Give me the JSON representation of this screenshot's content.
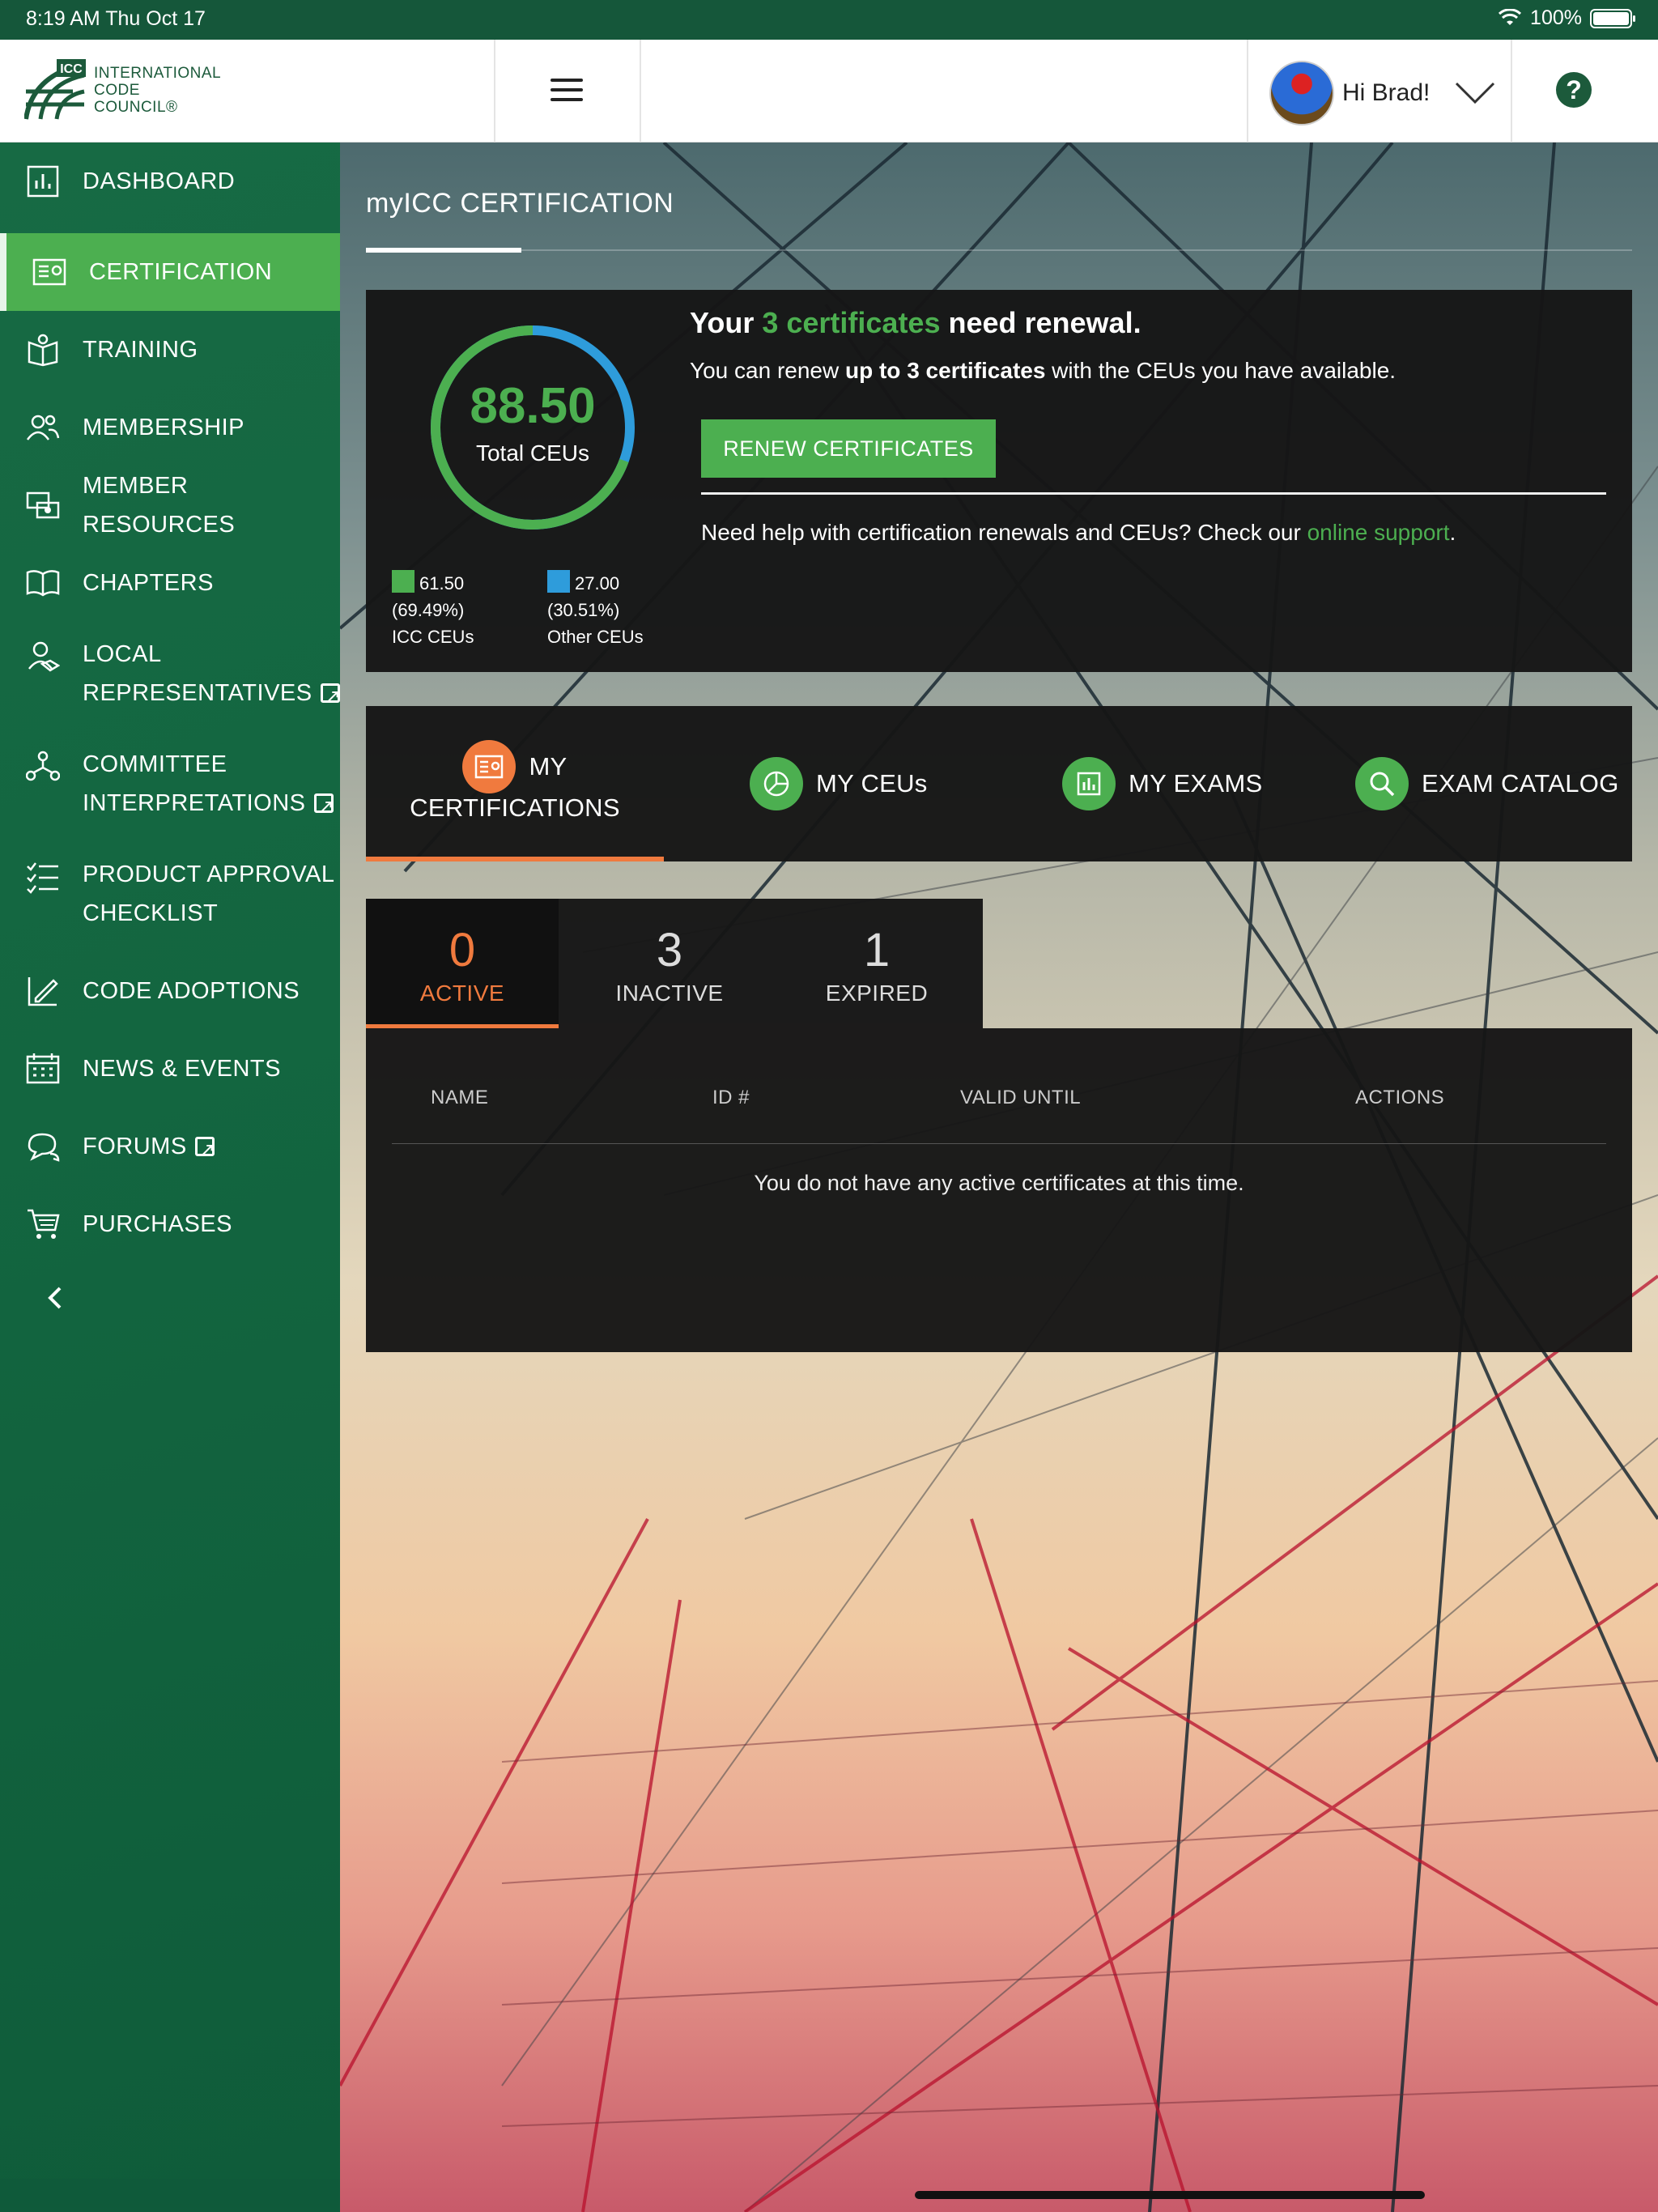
{
  "status_bar": {
    "time": "8:19 AM   Thu Oct 17",
    "battery": "100%"
  },
  "header": {
    "logo_mark": "ICC",
    "logo_lines": [
      "INTERNATIONAL",
      "CODE",
      "COUNCIL®"
    ],
    "greeting": "Hi Brad!",
    "help": "?"
  },
  "sidebar": {
    "items": [
      {
        "label": "DASHBOARD",
        "icon": "bar-chart-icon"
      },
      {
        "label": "CERTIFICATION",
        "icon": "certificate-icon"
      },
      {
        "label": "TRAINING",
        "icon": "training-icon"
      },
      {
        "label": "MEMBERSHIP",
        "icon": "people-icon"
      },
      {
        "label": "MEMBER RESOURCES",
        "icon": "resources-icon"
      },
      {
        "label": "CHAPTERS",
        "icon": "book-icon"
      },
      {
        "label": "LOCAL",
        "label2": "REPRESENTATIVES",
        "icon": "representatives-icon"
      },
      {
        "label": "COMMITTEE",
        "label2": "INTERPRETATIONS",
        "icon": "committee-icon"
      },
      {
        "label": "PRODUCT APPROVAL",
        "label2": "CHECKLIST",
        "icon": "checklist-icon"
      },
      {
        "label": "CODE ADOPTIONS",
        "icon": "code-adoption-icon"
      },
      {
        "label": "NEWS & EVENTS",
        "icon": "calendar-icon"
      },
      {
        "label": "FORUMS",
        "icon": "chat-icon"
      },
      {
        "label": "PURCHASES",
        "icon": "cart-icon"
      }
    ],
    "collapse": "‹"
  },
  "page": {
    "title": "myICC CERTIFICATION"
  },
  "ceu": {
    "total": "88.50",
    "total_label": "Total CEUs",
    "icc_value": "61.50",
    "icc_pct": "(69.49%)",
    "icc_label": "ICC CEUs",
    "other_value": "27.00",
    "other_pct": "(30.51%)",
    "other_label": "Other CEUs",
    "icc_fraction": 0.6949,
    "colors": {
      "icc": "#4caf50",
      "other": "#2e9cdb"
    }
  },
  "renewal": {
    "head_pre": "Your ",
    "head_hl": "3 certificates",
    "head_post": " need renewal.",
    "sub_pre": "You can renew ",
    "sub_bold": "up to 3 certificates",
    "sub_post": " with the CEUs you have available.",
    "button": "RENEW CERTIFICATES",
    "help_pre": "Need help with certification renewals and CEUs? Check our ",
    "help_link": "online support",
    "help_post": "."
  },
  "cert_tabs": [
    {
      "label": "MY",
      "label2": "CERTIFICATIONS",
      "icon": "certificate-icon"
    },
    {
      "label": "MY CEUs",
      "icon": "pie-icon"
    },
    {
      "label": "MY EXAMS",
      "icon": "exam-icon"
    },
    {
      "label": "EXAM CATALOG",
      "icon": "search-icon"
    }
  ],
  "status_tabs": [
    {
      "count": "0",
      "label": "ACTIVE"
    },
    {
      "count": "3",
      "label": "INACTIVE"
    },
    {
      "count": "1",
      "label": "EXPIRED"
    }
  ],
  "table": {
    "headers": [
      "NAME",
      "ID #",
      "VALID UNTIL",
      "ACTIONS"
    ],
    "empty": "You do not have any active certificates at this time."
  }
}
